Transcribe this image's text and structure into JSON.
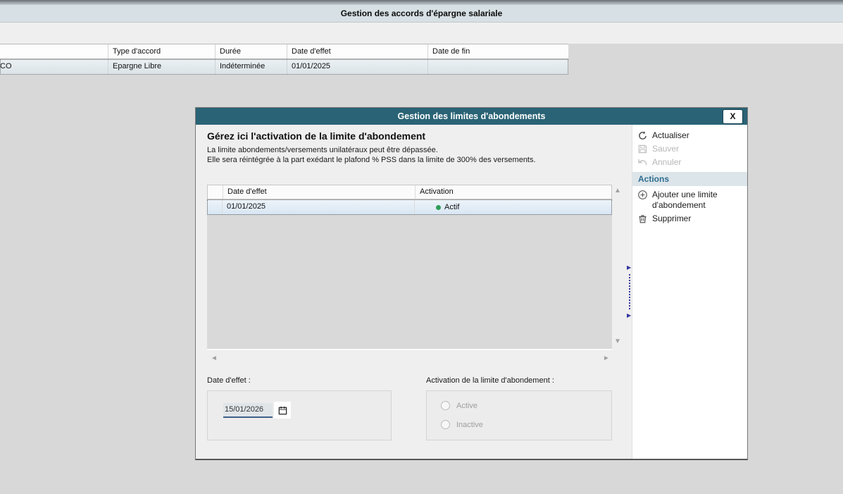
{
  "page": {
    "title": "Gestion des accords d'épargne salariale"
  },
  "accords_table": {
    "headers": [
      "",
      "Type d'accord",
      "Durée",
      "Date d'effet",
      "Date de fin"
    ],
    "row": [
      "CO",
      "Epargne Libre",
      "Indéterminée",
      "01/01/2025",
      ""
    ]
  },
  "dialog": {
    "title": "Gestion des limites d'abondements",
    "close": "X",
    "heading": "Gérez ici l'activation de la limite d'abondement",
    "description": [
      "La limite abondements/versements unilatéraux peut être dépassée.",
      "Elle sera réintégrée à la part exédant le plafond % PSS dans la limite de 300% des versements."
    ],
    "limits_table": {
      "headers": [
        "Date d'effet",
        "Activation"
      ],
      "row": {
        "date": "01/01/2025",
        "status": "Actif"
      }
    },
    "form": {
      "date_label": "Date d'effet :",
      "date_value": "15/01/2026",
      "activation_label": "Activation de la limite d'abondement :",
      "options": [
        "Active",
        "Inactive"
      ]
    }
  },
  "actions": {
    "actualiser": "Actualiser",
    "sauver": "Sauver",
    "annuler": "Annuler",
    "header": "Actions",
    "ajouter": "Ajouter une limite d'abondement",
    "supprimer": "Supprimer"
  },
  "icons": {
    "up": "▲",
    "down": "▼",
    "left": "◄",
    "right": "►",
    "splitter": "▶"
  },
  "colors": {
    "dialog_titlebar": "#2a6375",
    "page_titlebar": "#d7e0e4",
    "status_active_dot": "#2e9e57",
    "actions_header_text": "#2e6d90",
    "selected_row": "#d8e6f3"
  }
}
